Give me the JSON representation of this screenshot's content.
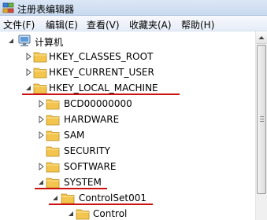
{
  "window": {
    "title": "注册表编辑器",
    "icon": "regedit-icon"
  },
  "menu": {
    "items": [
      {
        "label": "文件(F)"
      },
      {
        "label": "编辑(E)"
      },
      {
        "label": "查看(V)"
      },
      {
        "label": "收藏夹(A)"
      },
      {
        "label": "帮助(H)"
      }
    ]
  },
  "tree": {
    "items": [
      {
        "label": "计算机",
        "icon": "computer-icon",
        "state": "expanded",
        "level": 0
      },
      {
        "label": "HKEY_CLASSES_ROOT",
        "icon": "folder-icon",
        "state": "collapsed",
        "level": 1
      },
      {
        "label": "HKEY_CURRENT_USER",
        "icon": "folder-icon",
        "state": "collapsed",
        "level": 1
      },
      {
        "label": "HKEY_LOCAL_MACHINE",
        "icon": "folder-icon",
        "state": "expanded",
        "level": 1,
        "underlined": true
      },
      {
        "label": "BCD00000000",
        "icon": "folder-icon",
        "state": "collapsed",
        "level": 2
      },
      {
        "label": "HARDWARE",
        "icon": "folder-icon",
        "state": "collapsed",
        "level": 2
      },
      {
        "label": "SAM",
        "icon": "folder-icon",
        "state": "collapsed",
        "level": 2
      },
      {
        "label": "SECURITY",
        "icon": "folder-icon",
        "state": "none",
        "level": 2
      },
      {
        "label": "SOFTWARE",
        "icon": "folder-icon",
        "state": "collapsed",
        "level": 2
      },
      {
        "label": "SYSTEM",
        "icon": "folder-icon",
        "state": "expanded",
        "level": 2,
        "underlined": true
      },
      {
        "label": "ControlSet001",
        "icon": "folder-icon",
        "state": "expanded",
        "level": 3,
        "underlined": true
      },
      {
        "label": "Control",
        "icon": "folder-icon",
        "state": "expanded",
        "level": 4
      }
    ]
  },
  "colors": {
    "annotation_underline": "#cc1111",
    "folder": "#f3c54f"
  }
}
